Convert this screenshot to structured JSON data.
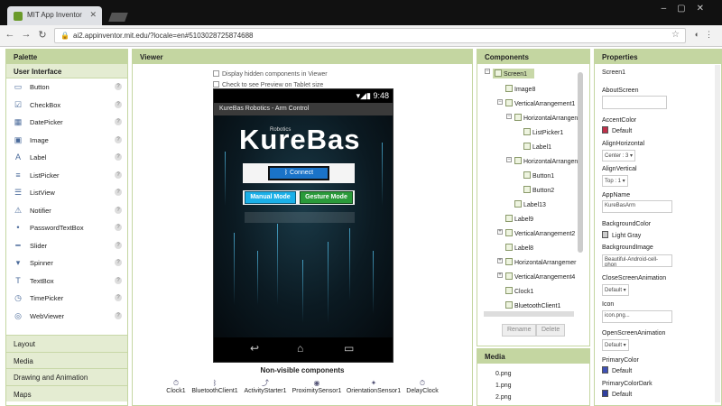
{
  "browser": {
    "tab_title": "MIT App Inventor",
    "url": "ai2.appinventor.mit.edu/?locale=en#5103028725874688"
  },
  "palette": {
    "title": "Palette",
    "section": "User Interface",
    "items": [
      {
        "label": "Button",
        "icon": "button-icon"
      },
      {
        "label": "CheckBox",
        "icon": "checkbox-icon"
      },
      {
        "label": "DatePicker",
        "icon": "datepicker-icon"
      },
      {
        "label": "Image",
        "icon": "image-icon"
      },
      {
        "label": "Label",
        "icon": "label-icon"
      },
      {
        "label": "ListPicker",
        "icon": "listpicker-icon"
      },
      {
        "label": "ListView",
        "icon": "listview-icon"
      },
      {
        "label": "Notifier",
        "icon": "notifier-icon"
      },
      {
        "label": "PasswordTextBox",
        "icon": "password-icon"
      },
      {
        "label": "Slider",
        "icon": "slider-icon"
      },
      {
        "label": "Spinner",
        "icon": "spinner-icon"
      },
      {
        "label": "TextBox",
        "icon": "textbox-icon"
      },
      {
        "label": "TimePicker",
        "icon": "timepicker-icon"
      },
      {
        "label": "WebViewer",
        "icon": "webviewer-icon"
      }
    ],
    "categories": [
      "Layout",
      "Media",
      "Drawing and Animation",
      "Maps"
    ]
  },
  "viewer": {
    "title": "Viewer",
    "display_hidden": "Display hidden components in Viewer",
    "tablet_preview": "Check to see Preview on Tablet size",
    "status_time": "9:48",
    "screen_title": "KureBas Robotics - Arm Control",
    "brand_small": "Robotics",
    "brand": "KureBas",
    "connect_label": "Connect",
    "manual_label": "Manual Mode",
    "gesture_label": "Gesture Mode",
    "nav_back": "↩",
    "nav_home": "⌂",
    "nav_recent": "▭",
    "nonvisible_title": "Non-visible components",
    "nonvisible": [
      "Clock1",
      "BluetoothClient1",
      "ActivityStarter1",
      "ProximitySensor1",
      "OrientationSensor1",
      "DelayClock"
    ]
  },
  "components": {
    "title": "Components",
    "tree": [
      "Screen1",
      "Image8",
      "VerticalArrangement1",
      "HorizontalArrangen",
      "ListPicker1",
      "Label1",
      "HorizontalArrangen",
      "Button1",
      "Button2",
      "Label13",
      "Label9",
      "VerticalArrangement2",
      "Label8",
      "HorizontalArrangemer",
      "VerticalArrangement4",
      "Clock1",
      "BluetoothClient1"
    ],
    "rename": "Rename",
    "delete": "Delete"
  },
  "media": {
    "title": "Media",
    "items": [
      "0.png",
      "1.png",
      "2.png"
    ]
  },
  "properties": {
    "title": "Properties",
    "component": "Screen1",
    "about_label": "AboutScreen",
    "accent_label": "AccentColor",
    "accent_value": "Default",
    "accent_color": "#c0304a",
    "alignh_label": "AlignHorizontal",
    "alignh_value": "Center : 3",
    "alignv_label": "AlignVertical",
    "alignv_value": "Top : 1",
    "appname_label": "AppName",
    "appname_value": "KureBasArm",
    "bgcolor_label": "BackgroundColor",
    "bgcolor_value": "Light Gray",
    "bgcolor_color": "#cccccc",
    "bgimage_label": "BackgroundImage",
    "bgimage_value": "Beautiful-Android-cell-phon",
    "closeanim_label": "CloseScreenAnimation",
    "closeanim_value": "Default",
    "icon_label": "Icon",
    "icon_value": "icon.png...",
    "openanim_label": "OpenScreenAnimation",
    "openanim_value": "Default",
    "primary_label": "PrimaryColor",
    "primary_value": "Default",
    "primary_color": "#3f51b5",
    "primarydark_label": "PrimaryColorDark",
    "primarydark_value": "Default",
    "primarydark_color": "#303f9f"
  }
}
